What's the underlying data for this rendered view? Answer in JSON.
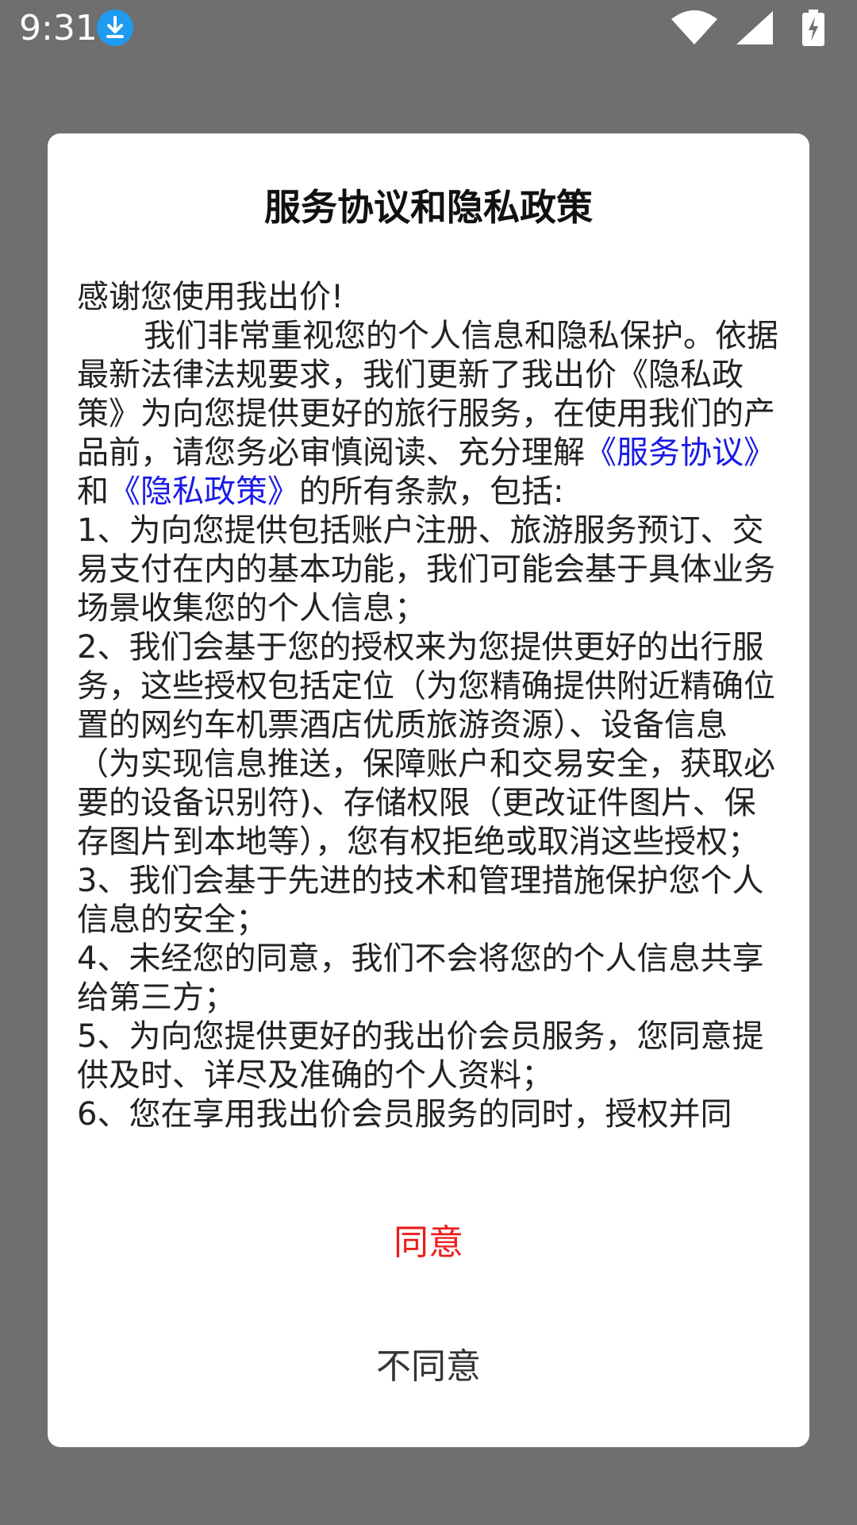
{
  "status_bar": {
    "time": "9:31",
    "icons": [
      "download-icon",
      "wifi-icon",
      "cell-signal-icon",
      "battery-charging-icon"
    ]
  },
  "dialog": {
    "title": "服务协议和隐私政策",
    "greeting": "感谢您使用我出价!",
    "intro_pre": "我们非常重视您的个人信息和隐私保护。依据最新法律法规要求，我们更新了我出价《隐私政策》为向您提供更好的旅行服务，在使用我们的产品前，请您务必审慎阅读、充分理解",
    "service_link": "《服务协议》",
    "conjunction": "和",
    "privacy_link": "《隐私政策》",
    "intro_post": "的所有条款，包括:",
    "items": [
      "1、为向您提供包括账户注册、旅游服务预订、交易支付在内的基本功能，我们可能会基于具体业务场景收集您的个人信息；",
      "2、我们会基于您的授权来为您提供更好的出行服务，这些授权包括定位（为您精确提供附近精确位置的网约车机票酒店优质旅游资源）、设备信息（为实现信息推送，保障账户和交易安全，获取必要的设备识别符)、存储权限（更改证件图片、保存图片到本地等），您有权拒绝或取消这些授权；",
      "3、我们会基于先进的技术和管理措施保护您个人信息的安全；",
      "4、未经您的同意，我们不会将您的个人信息共享给第三方；",
      "5、为向您提供更好的我出价会员服务，您同意提供及时、详尽及准确的个人资料；",
      "6、您在享用我出价会员服务的同时，授权并同"
    ],
    "agree_label": "同意",
    "disagree_label": "不同意"
  },
  "colors": {
    "overlay": "#6f6f6f",
    "link": "#1a1ae6",
    "agree": "#ee1c1c"
  }
}
